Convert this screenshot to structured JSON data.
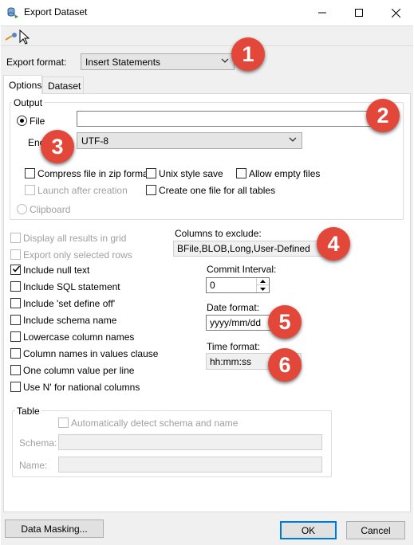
{
  "window": {
    "title": "Export Dataset",
    "icon": "dataset-export-icon"
  },
  "toolbar": {
    "icon": "brush-cursor-icon"
  },
  "export_format": {
    "label": "Export format:",
    "value": "Insert Statements"
  },
  "tabs": [
    {
      "label": "Options",
      "active": true
    },
    {
      "label": "Dataset",
      "active": false
    }
  ],
  "output": {
    "group_title": "Output",
    "file_label": "File",
    "file_path": "",
    "encoding_label": "Enc",
    "encoding_value": "UTF-8",
    "compress_label": "Compress file in zip format",
    "unix_label": "Unix style save",
    "allow_empty_label": "Allow empty files",
    "launch_label": "Launch after creation",
    "one_file_label": "Create one file for all tables",
    "clipboard_label": "Clipboard"
  },
  "options": {
    "display_all": "Display all results in grid",
    "export_selected": "Export only selected rows",
    "include_null": "Include null text",
    "include_sql": "Include SQL statement",
    "include_define_off": "Include 'set define off'",
    "include_schema": "Include schema name",
    "lowercase": "Lowercase column names",
    "col_names_values": "Column names in values clause",
    "one_col_per_line": "One column value per line",
    "use_n": "Use N' for national columns"
  },
  "columns_to_exclude": {
    "label": "Columns to exclude:",
    "value": "BFile,BLOB,Long,User-Defined"
  },
  "commit_interval": {
    "label": "Commit Interval:",
    "value": "0"
  },
  "date_format": {
    "label": "Date format:",
    "value": "yyyy/mm/dd"
  },
  "time_format": {
    "label": "Time format:",
    "value": "hh:mm:ss"
  },
  "table": {
    "group_title": "Table",
    "auto_detect": "Automatically detect schema and name",
    "schema_label": "Schema:",
    "name_label": "Name:"
  },
  "buttons": {
    "data_masking": "Data Masking...",
    "ok": "OK",
    "cancel": "Cancel"
  },
  "badges": [
    "1",
    "2",
    "3",
    "4",
    "5",
    "6"
  ],
  "colors": {
    "badge": "#e2473a",
    "accent": "#0078d7"
  }
}
